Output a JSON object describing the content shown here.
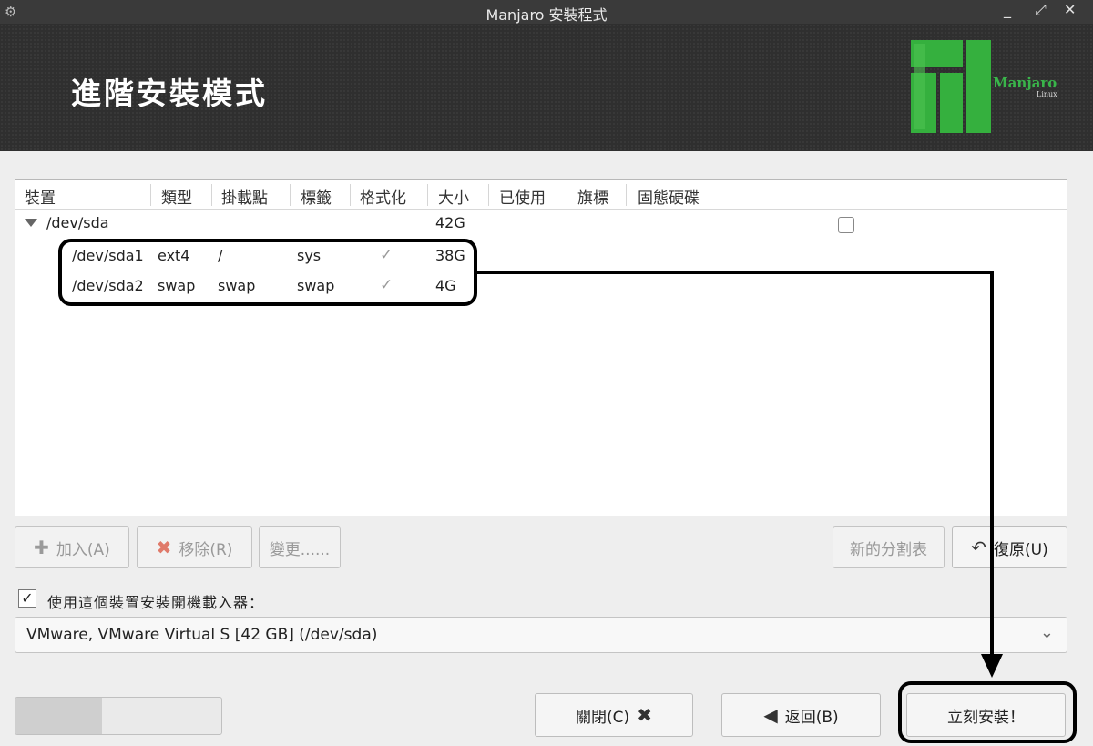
{
  "window": {
    "title": "Manjaro 安裝程式",
    "controls": {
      "minimize": "_",
      "maximize": "⤢",
      "close": "✕"
    }
  },
  "header": {
    "heading": "進階安裝模式",
    "logo_text": "Manjaro",
    "logo_subtext": "Linux",
    "brand_color": "#39b54a"
  },
  "table": {
    "columns": [
      "裝置",
      "類型",
      "掛載點",
      "標籤",
      "格式化",
      "大小",
      "已使用",
      "旗標",
      "固態硬碟"
    ],
    "root": {
      "device": "/dev/sda",
      "size": "42G"
    },
    "rows": [
      {
        "device": "/dev/sda1",
        "type": "ext4",
        "mount": "/",
        "label": "sys",
        "format": true,
        "size": "38G"
      },
      {
        "device": "/dev/sda2",
        "type": "swap",
        "mount": "swap",
        "label": "swap",
        "format": true,
        "size": "4G"
      }
    ],
    "check_glyph": "✓"
  },
  "buttons": {
    "add": "加入(A)",
    "remove": "移除(R)",
    "edit": "變更......",
    "new_table": "新的分割表",
    "revert": "復原(U)",
    "close": "關閉(C)",
    "back": "返回(B)",
    "install": "立刻安裝！"
  },
  "bootloader": {
    "checked": true,
    "label": "使用這個裝置安裝開機載入器：",
    "device": "VMware, VMware Virtual S [42 GB] (/dev/sda)"
  },
  "progress": {
    "fraction": 0.42
  }
}
